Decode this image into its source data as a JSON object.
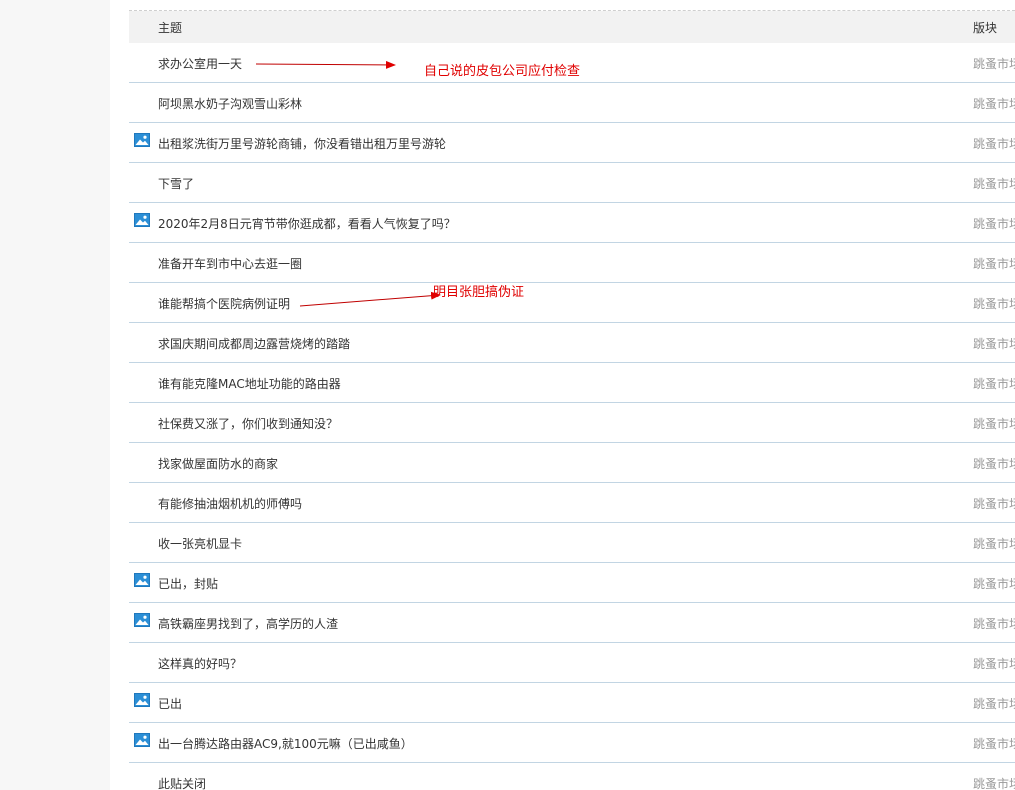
{
  "header": {
    "subject_label": "主题",
    "board_label": "版块"
  },
  "rows": [
    {
      "title": "求办公室用一天",
      "board": "跳蚤市场",
      "has_image": false
    },
    {
      "title": "阿坝黑水奶子沟观雪山彩林",
      "board": "跳蚤市场",
      "has_image": false
    },
    {
      "title": "出租浆洗街万里号游轮商铺，你没看错出租万里号游轮",
      "board": "跳蚤市场",
      "has_image": true
    },
    {
      "title": "下雪了",
      "board": "跳蚤市场",
      "has_image": false
    },
    {
      "title": "2020年2月8日元宵节带你逛成都，看看人气恢复了吗？",
      "board": "跳蚤市场",
      "has_image": true
    },
    {
      "title": "准备开车到市中心去逛一圈",
      "board": "跳蚤市场",
      "has_image": false
    },
    {
      "title": "谁能帮搞个医院病例证明",
      "board": "跳蚤市场",
      "has_image": false
    },
    {
      "title": "求国庆期间成都周边露营烧烤的踏踏",
      "board": "跳蚤市场",
      "has_image": false
    },
    {
      "title": "谁有能克隆MAC地址功能的路由器",
      "board": "跳蚤市场",
      "has_image": false
    },
    {
      "title": "社保费又涨了，你们收到通知没？",
      "board": "跳蚤市场",
      "has_image": false
    },
    {
      "title": "找家做屋面防水的商家",
      "board": "跳蚤市场",
      "has_image": false
    },
    {
      "title": "有能修抽油烟机机的师傅吗",
      "board": "跳蚤市场",
      "has_image": false
    },
    {
      "title": "收一张亮机显卡",
      "board": "跳蚤市场",
      "has_image": false
    },
    {
      "title": "已出，封贴",
      "board": "跳蚤市场",
      "has_image": true
    },
    {
      "title": "高铁霸座男找到了，高学历的人渣",
      "board": "跳蚤市场",
      "has_image": true
    },
    {
      "title": "这样真的好吗？",
      "board": "跳蚤市场",
      "has_image": false
    },
    {
      "title": "已出",
      "board": "跳蚤市场",
      "has_image": true
    },
    {
      "title": "出一台腾达路由器AC9,就100元嘛（已出咸鱼）",
      "board": "跳蚤市场",
      "has_image": true
    },
    {
      "title": "此贴关闭",
      "board": "跳蚤市场",
      "has_image": false
    }
  ],
  "annotations": [
    {
      "text": "自己说的皮包公司应付检查"
    },
    {
      "text": "明目张胆搞伪证"
    }
  ],
  "colors": {
    "annotation": "#e00000",
    "row_divider": "#c2d5e3",
    "header_bg": "#f2f2f2",
    "image_icon": "#2c8fd6"
  },
  "icons": {
    "image": "image-icon"
  }
}
